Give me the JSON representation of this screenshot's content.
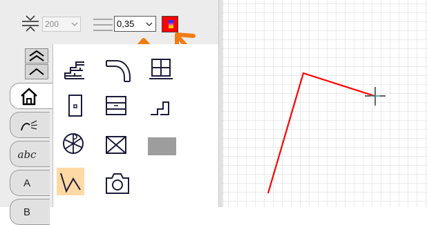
{
  "toolbar": {
    "line_width": {
      "value": "200",
      "icon": "line-width-icon"
    },
    "line_thickness": {
      "value": "0,35",
      "icon": "line-thickness-icon"
    },
    "color": {
      "primary": "#ff0000",
      "icon": "color-picker-icon"
    },
    "annotation_arrow_color": "#f07d14"
  },
  "tabs": [
    {
      "name": "tab-scroll-top",
      "icon": "double-chevron-up-icon"
    },
    {
      "name": "tab-scroll-up",
      "icon": "chevron-up-icon"
    },
    {
      "name": "tab-building",
      "icon": "house-icon",
      "active": true
    },
    {
      "name": "tab-electrical",
      "icon": "sprinkler-icon"
    },
    {
      "name": "tab-text",
      "label": "abc"
    },
    {
      "name": "tab-a",
      "label": "A"
    },
    {
      "name": "tab-b",
      "label": "B"
    }
  ],
  "palette": {
    "tools": [
      {
        "name": "wall-tool",
        "icon": "brick-wall-icon"
      },
      {
        "name": "curved-wall-tool",
        "icon": "curved-wall-icon"
      },
      {
        "name": "window-grid-tool",
        "icon": "window-grid-icon"
      },
      {
        "name": "door-tool",
        "icon": "door-icon"
      },
      {
        "name": "cabinet-tool",
        "icon": "cabinet-icon"
      },
      {
        "name": "stairs-tool",
        "icon": "stairs-icon"
      },
      {
        "name": "fan-tool",
        "icon": "fan-icon"
      },
      {
        "name": "crossed-box-tool",
        "icon": "crossed-box-icon"
      },
      {
        "name": "fill-tool",
        "icon": "gray-fill-icon"
      },
      {
        "name": "polyline-tool",
        "icon": "polyline-icon",
        "selected": true
      },
      {
        "name": "camera-tool",
        "icon": "camera-icon"
      }
    ]
  },
  "canvas": {
    "grid_color": "#d6d6d6",
    "line_color": "#ff0000",
    "cursor": "crosshair-icon"
  }
}
